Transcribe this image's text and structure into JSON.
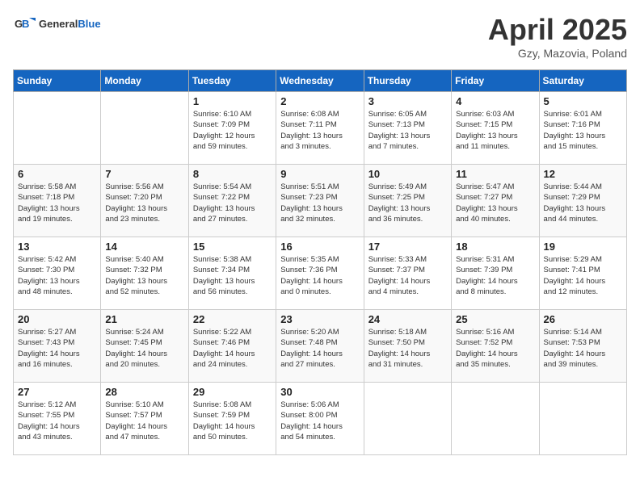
{
  "header": {
    "logo_general": "General",
    "logo_blue": "Blue",
    "month_title": "April 2025",
    "location": "Gzy, Mazovia, Poland"
  },
  "weekdays": [
    "Sunday",
    "Monday",
    "Tuesday",
    "Wednesday",
    "Thursday",
    "Friday",
    "Saturday"
  ],
  "weeks": [
    [
      {
        "day": "",
        "info": ""
      },
      {
        "day": "",
        "info": ""
      },
      {
        "day": "1",
        "info": "Sunrise: 6:10 AM\nSunset: 7:09 PM\nDaylight: 12 hours\nand 59 minutes."
      },
      {
        "day": "2",
        "info": "Sunrise: 6:08 AM\nSunset: 7:11 PM\nDaylight: 13 hours\nand 3 minutes."
      },
      {
        "day": "3",
        "info": "Sunrise: 6:05 AM\nSunset: 7:13 PM\nDaylight: 13 hours\nand 7 minutes."
      },
      {
        "day": "4",
        "info": "Sunrise: 6:03 AM\nSunset: 7:15 PM\nDaylight: 13 hours\nand 11 minutes."
      },
      {
        "day": "5",
        "info": "Sunrise: 6:01 AM\nSunset: 7:16 PM\nDaylight: 13 hours\nand 15 minutes."
      }
    ],
    [
      {
        "day": "6",
        "info": "Sunrise: 5:58 AM\nSunset: 7:18 PM\nDaylight: 13 hours\nand 19 minutes."
      },
      {
        "day": "7",
        "info": "Sunrise: 5:56 AM\nSunset: 7:20 PM\nDaylight: 13 hours\nand 23 minutes."
      },
      {
        "day": "8",
        "info": "Sunrise: 5:54 AM\nSunset: 7:22 PM\nDaylight: 13 hours\nand 27 minutes."
      },
      {
        "day": "9",
        "info": "Sunrise: 5:51 AM\nSunset: 7:23 PM\nDaylight: 13 hours\nand 32 minutes."
      },
      {
        "day": "10",
        "info": "Sunrise: 5:49 AM\nSunset: 7:25 PM\nDaylight: 13 hours\nand 36 minutes."
      },
      {
        "day": "11",
        "info": "Sunrise: 5:47 AM\nSunset: 7:27 PM\nDaylight: 13 hours\nand 40 minutes."
      },
      {
        "day": "12",
        "info": "Sunrise: 5:44 AM\nSunset: 7:29 PM\nDaylight: 13 hours\nand 44 minutes."
      }
    ],
    [
      {
        "day": "13",
        "info": "Sunrise: 5:42 AM\nSunset: 7:30 PM\nDaylight: 13 hours\nand 48 minutes."
      },
      {
        "day": "14",
        "info": "Sunrise: 5:40 AM\nSunset: 7:32 PM\nDaylight: 13 hours\nand 52 minutes."
      },
      {
        "day": "15",
        "info": "Sunrise: 5:38 AM\nSunset: 7:34 PM\nDaylight: 13 hours\nand 56 minutes."
      },
      {
        "day": "16",
        "info": "Sunrise: 5:35 AM\nSunset: 7:36 PM\nDaylight: 14 hours\nand 0 minutes."
      },
      {
        "day": "17",
        "info": "Sunrise: 5:33 AM\nSunset: 7:37 PM\nDaylight: 14 hours\nand 4 minutes."
      },
      {
        "day": "18",
        "info": "Sunrise: 5:31 AM\nSunset: 7:39 PM\nDaylight: 14 hours\nand 8 minutes."
      },
      {
        "day": "19",
        "info": "Sunrise: 5:29 AM\nSunset: 7:41 PM\nDaylight: 14 hours\nand 12 minutes."
      }
    ],
    [
      {
        "day": "20",
        "info": "Sunrise: 5:27 AM\nSunset: 7:43 PM\nDaylight: 14 hours\nand 16 minutes."
      },
      {
        "day": "21",
        "info": "Sunrise: 5:24 AM\nSunset: 7:45 PM\nDaylight: 14 hours\nand 20 minutes."
      },
      {
        "day": "22",
        "info": "Sunrise: 5:22 AM\nSunset: 7:46 PM\nDaylight: 14 hours\nand 24 minutes."
      },
      {
        "day": "23",
        "info": "Sunrise: 5:20 AM\nSunset: 7:48 PM\nDaylight: 14 hours\nand 27 minutes."
      },
      {
        "day": "24",
        "info": "Sunrise: 5:18 AM\nSunset: 7:50 PM\nDaylight: 14 hours\nand 31 minutes."
      },
      {
        "day": "25",
        "info": "Sunrise: 5:16 AM\nSunset: 7:52 PM\nDaylight: 14 hours\nand 35 minutes."
      },
      {
        "day": "26",
        "info": "Sunrise: 5:14 AM\nSunset: 7:53 PM\nDaylight: 14 hours\nand 39 minutes."
      }
    ],
    [
      {
        "day": "27",
        "info": "Sunrise: 5:12 AM\nSunset: 7:55 PM\nDaylight: 14 hours\nand 43 minutes."
      },
      {
        "day": "28",
        "info": "Sunrise: 5:10 AM\nSunset: 7:57 PM\nDaylight: 14 hours\nand 47 minutes."
      },
      {
        "day": "29",
        "info": "Sunrise: 5:08 AM\nSunset: 7:59 PM\nDaylight: 14 hours\nand 50 minutes."
      },
      {
        "day": "30",
        "info": "Sunrise: 5:06 AM\nSunset: 8:00 PM\nDaylight: 14 hours\nand 54 minutes."
      },
      {
        "day": "",
        "info": ""
      },
      {
        "day": "",
        "info": ""
      },
      {
        "day": "",
        "info": ""
      }
    ]
  ]
}
